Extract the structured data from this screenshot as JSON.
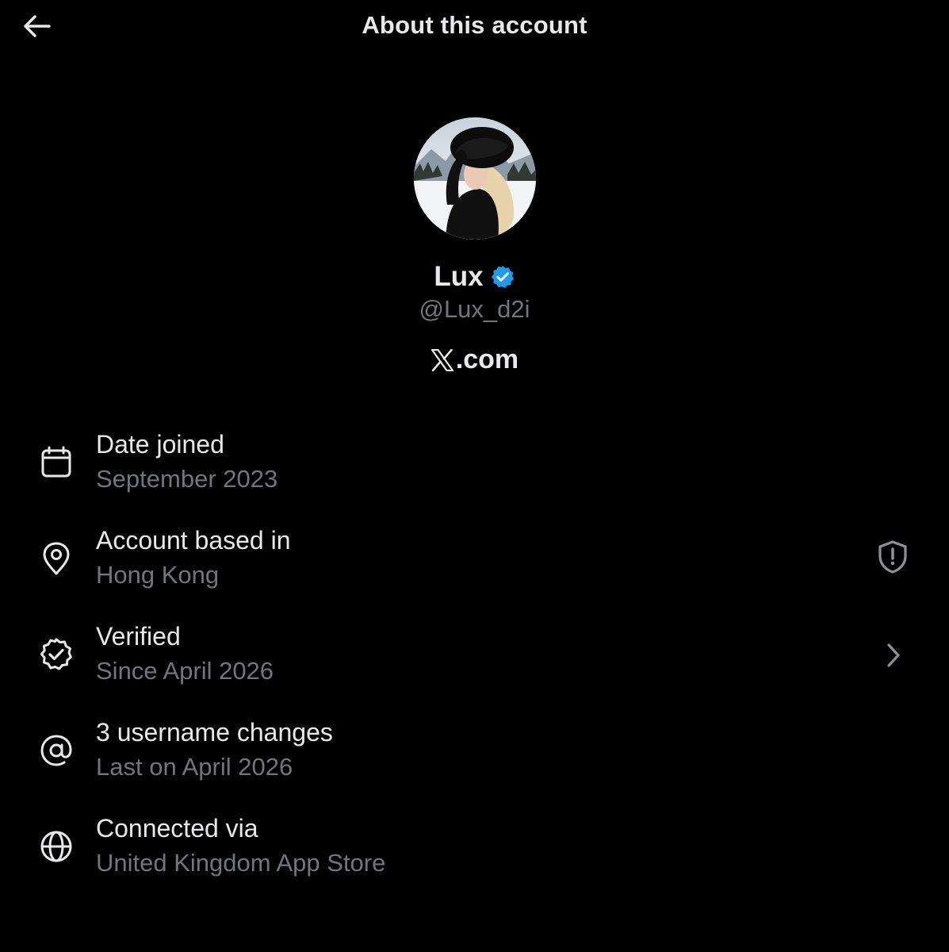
{
  "header": {
    "title": "About this account",
    "back_icon": "arrow-left-icon"
  },
  "profile": {
    "display_name": "Lux",
    "verified_icon": "verified-badge-icon",
    "verified_color": "#1d9bf0",
    "handle": "@Lux_d2i",
    "site_label": ".com",
    "site_logo": "x-logo-icon"
  },
  "info_items": [
    {
      "icon": "calendar-icon",
      "label": "Date joined",
      "value": "September 2023"
    },
    {
      "icon": "location-pin-icon",
      "label": "Account based in",
      "value": "Hong Kong",
      "trailing_icon": "shield-alert-icon"
    },
    {
      "icon": "verified-outline-icon",
      "label": "Verified",
      "value": "Since April 2026",
      "trailing_icon": "chevron-right-icon"
    },
    {
      "icon": "at-sign-icon",
      "label": "3 username changes",
      "value": "Last on April 2026"
    },
    {
      "icon": "globe-icon",
      "label": "Connected via",
      "value": "United Kingdom App Store"
    }
  ],
  "colors": {
    "background": "#000000",
    "primary_text": "#e7e9ea",
    "secondary_text": "#71767b",
    "accent": "#1d9bf0"
  }
}
